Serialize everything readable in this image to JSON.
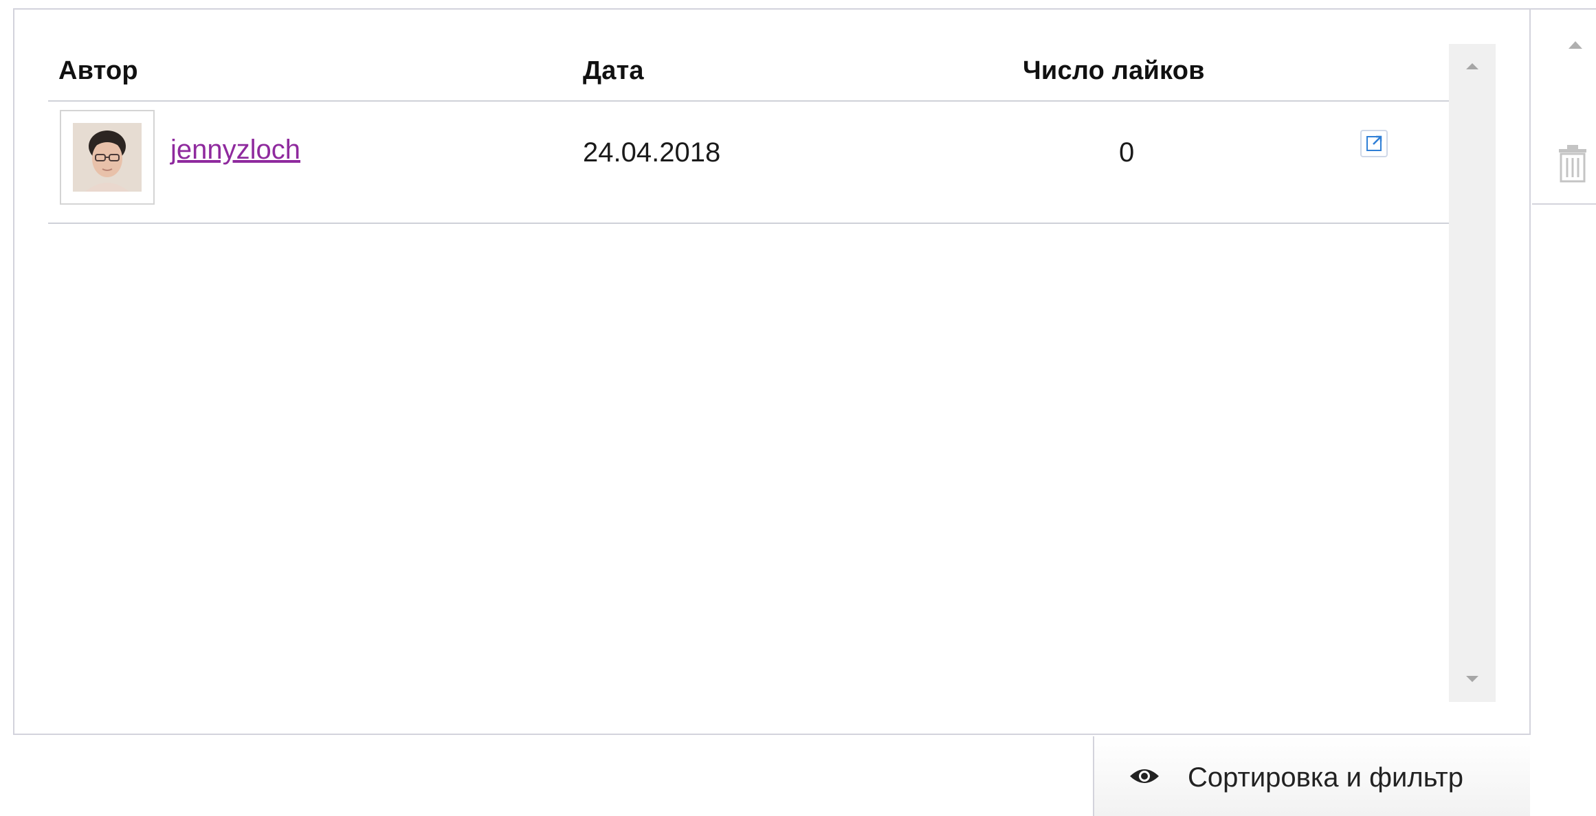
{
  "table": {
    "columns": [
      "Автор",
      "Дата",
      "Число лайков"
    ],
    "rows": [
      {
        "author": "jennyzloch",
        "date": "24.04.2018",
        "likes": "0"
      }
    ]
  },
  "footer": {
    "sort_filter_label": "Сортировка и фильтр"
  },
  "icons": {
    "external_link": "external-link-icon",
    "scroll_up": "triangle-up-icon",
    "scroll_down": "triangle-down-icon",
    "side_up": "triangle-up-icon",
    "trash": "trash-icon",
    "eye": "eye-icon"
  },
  "colors": {
    "link": "#8f2a9e",
    "divider": "#d3d3dc",
    "scrollbar": "#f0f0f0",
    "external_link_icon": "#2f7fd6"
  }
}
